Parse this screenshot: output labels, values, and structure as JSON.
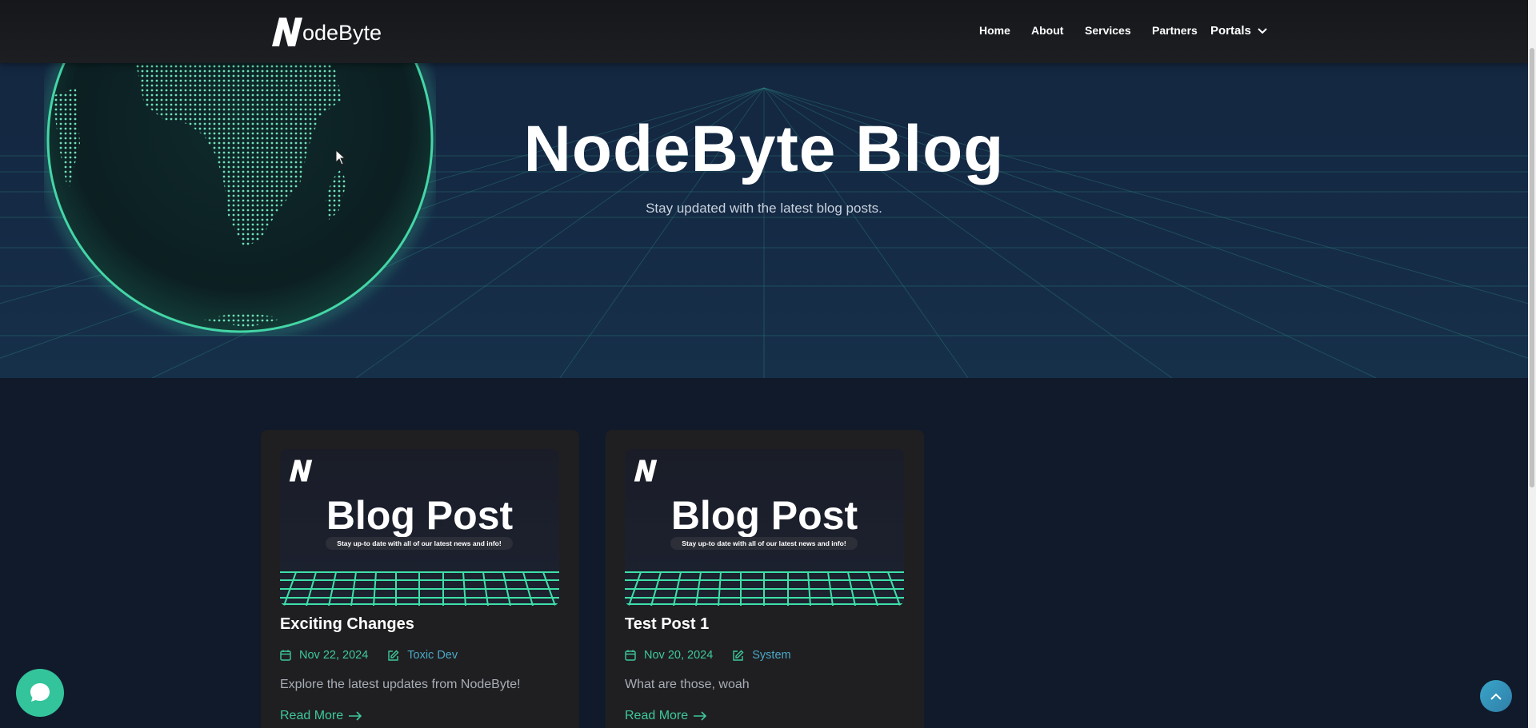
{
  "brand": {
    "logo_mark": "N",
    "logo_text": "odeByte"
  },
  "nav": {
    "items": [
      {
        "label": "Home"
      },
      {
        "label": "About"
      },
      {
        "label": "Services"
      },
      {
        "label": "Partners"
      }
    ],
    "portals_label": "Portals",
    "portals_icon": "chevron-down-icon"
  },
  "hero": {
    "title": "NodeByte Blog",
    "subtitle": "Stay updated with the latest blog posts."
  },
  "posts": [
    {
      "thumb_title": "Blog Post",
      "thumb_tagline": "Stay up-to date with all of our latest news and info!",
      "title": "Exciting Changes",
      "date": "Nov 22, 2024",
      "author": "Toxic Dev",
      "excerpt": "Explore the latest updates from NodeByte!",
      "read_more": "Read More"
    },
    {
      "thumb_title": "Blog Post",
      "thumb_tagline": "Stay up-to date with all of our latest news and info!",
      "title": "Test Post 1",
      "date": "Nov 20, 2024",
      "author": "System",
      "excerpt": "What are those, woah",
      "read_more": "Read More"
    }
  ],
  "colors": {
    "accent": "#3ec99a",
    "author": "#4ba8c7",
    "card_bg": "#1f1f21",
    "page_bg": "#111a2b"
  },
  "icons": {
    "chat": "chat-bubble-icon",
    "back_to_top": "chevron-up-icon",
    "date": "calendar-icon",
    "author": "edit-icon",
    "read_more": "arrow-right-icon"
  }
}
